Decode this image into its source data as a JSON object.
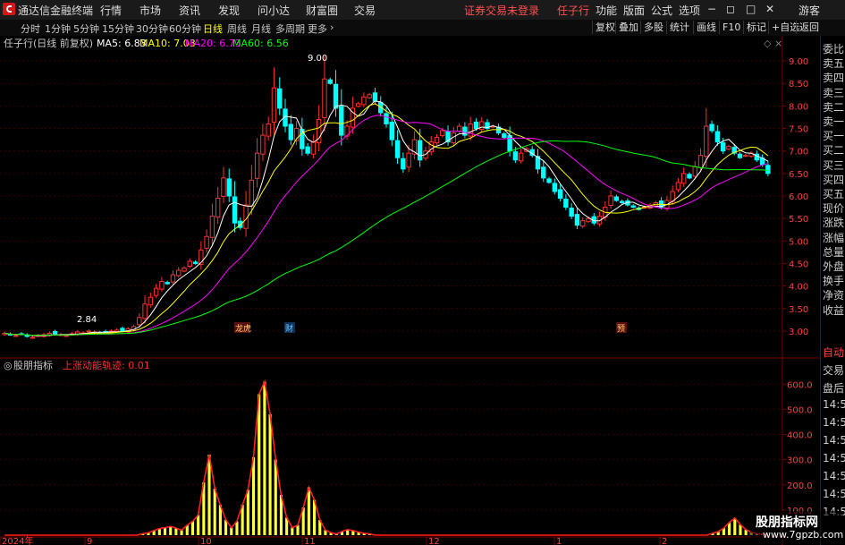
{
  "titlebar": {
    "app_name": "通达信金融终端",
    "menus": [
      "行情",
      "市场",
      "资讯",
      "发现",
      "问小达",
      "财富圈",
      "交易"
    ],
    "status": "证券交易未登录",
    "stock": "任子行",
    "right_menus": [
      "功能",
      "版面",
      "公式",
      "选项"
    ],
    "user": "游客"
  },
  "toolbar": {
    "periods": [
      "分时",
      "1分钟",
      "5分钟",
      "15分钟",
      "30分钟",
      "60分钟",
      "日线",
      "周线",
      "月线",
      "多周期",
      "更多"
    ],
    "active_period": "日线",
    "right_buttons": [
      "复权",
      "叠加",
      "多股",
      "统计",
      "画线",
      "F10",
      "标记",
      "+自选",
      "返回"
    ]
  },
  "main_legend": {
    "title": "任子行(日线 前复权)",
    "ma5": "MA5: 6.83",
    "ma10": "MA10: 7.03",
    "ma20": "MA20: 6.73",
    "ma60": "MA60: 6.56"
  },
  "sub_legend": {
    "title": "股朋指标",
    "series": "上涨动能轨迹: 0.01"
  },
  "markers": {
    "high": "9.00",
    "low": "2.84",
    "tag1": "龙虎",
    "tag2": "财",
    "tag3": "预"
  },
  "right_panel": {
    "labels": [
      "委比",
      "卖五",
      "卖四",
      "卖三",
      "卖二",
      "卖一",
      "买一",
      "买二",
      "买三",
      "买四",
      "买五",
      "现价",
      "涨跌",
      "涨幅",
      "总量",
      "外盘",
      "换手",
      "净资",
      "收益"
    ],
    "lower_labels": [
      "自动",
      "交易",
      "盘后",
      "14:5",
      "14:5",
      "14:5",
      "14:5",
      "14:5",
      "14:5",
      "14:5"
    ]
  },
  "watermark": {
    "title": "股朋指标网",
    "url": "www.7gpzb.com"
  },
  "colors": {
    "up": "#ff3030",
    "down": "#00ffff",
    "ma5": "#ffffff",
    "ma10": "#ffff00",
    "ma20": "#ff00ff",
    "ma60": "#00ff00"
  },
  "chart_data": [
    {
      "type": "candlestick",
      "title": "任子行(日线 前复权)",
      "y_ticks": [
        "9.00",
        "8.50",
        "8.00",
        "7.50",
        "7.00",
        "6.50",
        "6.00",
        "5.50",
        "5.00",
        "4.50",
        "4.00",
        "3.50",
        "3.00"
      ],
      "ylim": [
        2.7,
        9.2
      ],
      "time_ticks": [
        "2024年",
        "9",
        "10",
        "11",
        "12",
        "1",
        "2"
      ],
      "close": [
        2.95,
        2.92,
        2.9,
        2.93,
        2.88,
        2.86,
        2.9,
        2.92,
        2.95,
        2.93,
        2.92,
        2.9,
        2.94,
        2.98,
        2.96,
        3.0,
        2.98,
        2.95,
        2.97,
        3.0,
        3.02,
        3.0,
        3.05,
        3.1,
        3.3,
        3.6,
        3.75,
        3.95,
        4.1,
        4.05,
        4.25,
        4.35,
        4.4,
        4.55,
        4.5,
        4.8,
        5.1,
        5.55,
        5.95,
        6.4,
        6.0,
        5.4,
        5.3,
        5.8,
        6.35,
        6.95,
        7.35,
        7.6,
        8.4,
        7.95,
        7.55,
        7.25,
        7.5,
        7.05,
        6.95,
        7.2,
        7.7,
        8.6,
        8.5,
        7.95,
        7.35,
        7.55,
        7.95,
        8.05,
        8.2,
        8.25,
        8.1,
        7.85,
        7.6,
        7.25,
        6.85,
        6.6,
        6.95,
        7.25,
        6.8,
        7.0,
        7.2,
        7.3,
        7.45,
        7.2,
        7.4,
        7.55,
        7.35,
        7.6,
        7.5,
        7.65,
        7.5,
        7.55,
        7.4,
        7.3,
        7.0,
        6.8,
        6.95,
        7.05,
        6.9,
        6.6,
        6.4,
        6.3,
        6.1,
        5.95,
        5.75,
        5.55,
        5.35,
        5.45,
        5.5,
        5.4,
        5.55,
        5.75,
        6.0,
        5.9,
        5.85,
        5.8,
        5.75,
        5.7,
        5.75,
        5.8,
        5.85,
        5.75,
        5.9,
        6.1,
        6.3,
        6.5,
        6.4,
        6.65,
        6.9,
        7.55,
        7.45,
        7.2,
        7.0,
        7.1,
        6.95,
        6.85,
        6.9,
        6.95,
        6.8,
        6.7,
        6.5
      ],
      "ma_legend": {
        "MA5": 6.83,
        "MA10": 7.03,
        "MA20": 6.73,
        "MA60": 6.56
      },
      "high_label": 9.0,
      "low_label": 2.84
    },
    {
      "type": "bar",
      "title": "股朋指标",
      "series_name": "上涨动能轨迹",
      "last_value": 0.01,
      "y_ticks": [
        "600.0",
        "500.0",
        "400.0",
        "300.0",
        "200.0",
        "100.0"
      ],
      "ylim": [
        0,
        640
      ],
      "values": [
        0,
        0,
        0,
        0,
        0,
        0,
        0,
        0,
        0,
        0,
        0,
        0,
        0,
        0,
        0,
        0,
        0,
        0,
        0,
        0,
        0,
        0,
        0,
        0,
        0,
        6,
        10,
        18,
        26,
        30,
        35,
        28,
        20,
        40,
        55,
        80,
        210,
        320,
        185,
        120,
        60,
        30,
        55,
        120,
        180,
        310,
        560,
        610,
        480,
        300,
        160,
        70,
        30,
        40,
        110,
        190,
        140,
        60,
        20,
        10,
        5,
        15,
        22,
        18,
        12,
        8,
        5,
        0,
        0,
        0,
        0,
        0,
        0,
        0,
        0,
        0,
        0,
        0,
        0,
        0,
        0,
        0,
        0,
        0,
        0,
        0,
        0,
        0,
        0,
        0,
        0,
        0,
        0,
        0,
        0,
        0,
        0,
        0,
        0,
        0,
        0,
        0,
        0,
        0,
        0,
        0,
        0,
        0,
        0,
        0,
        0,
        0,
        0,
        0,
        0,
        0,
        0,
        0,
        0,
        0,
        0,
        0,
        0,
        0,
        0,
        0,
        0,
        0,
        8,
        14,
        28,
        50,
        68,
        42,
        22,
        12,
        6,
        4,
        0
      ]
    }
  ]
}
